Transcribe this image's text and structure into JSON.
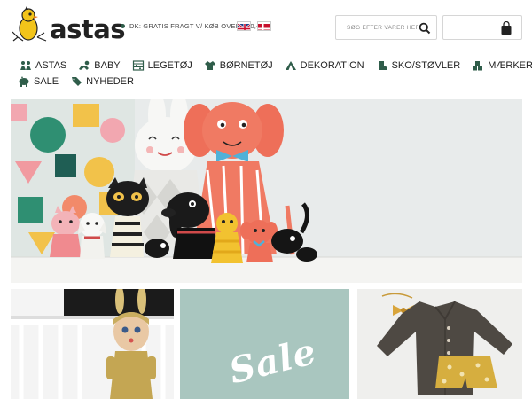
{
  "brand": {
    "name": "astas"
  },
  "header": {
    "shipping_note": "DK: GRATIS FRAGT V/ KØB OVER 600,-",
    "search_placeholder": "SØG EFTER VARER HER..."
  },
  "nav": {
    "row1": [
      {
        "label": "ASTAS",
        "icon": "kids-icon"
      },
      {
        "label": "BABY",
        "icon": "baby-icon"
      },
      {
        "label": "LEGETØJ",
        "icon": "toy-icon"
      },
      {
        "label": "BØRNETØJ",
        "icon": "shirt-icon"
      },
      {
        "label": "DEKORATION",
        "icon": "tent-icon"
      },
      {
        "label": "SKO/STØVLER",
        "icon": "boot-icon"
      },
      {
        "label": "MÆRKER",
        "icon": "blocks-icon"
      }
    ],
    "row2": [
      {
        "label": "SALE",
        "icon": "pig-icon"
      },
      {
        "label": "NYHEDER",
        "icon": "tag-icon"
      }
    ]
  },
  "tiles": {
    "sale_label": "Sale"
  },
  "colors": {
    "nav_icon": "#2f5d4a",
    "sale_tile": "#a9c6bf",
    "doll_coral": "#e8705a"
  }
}
